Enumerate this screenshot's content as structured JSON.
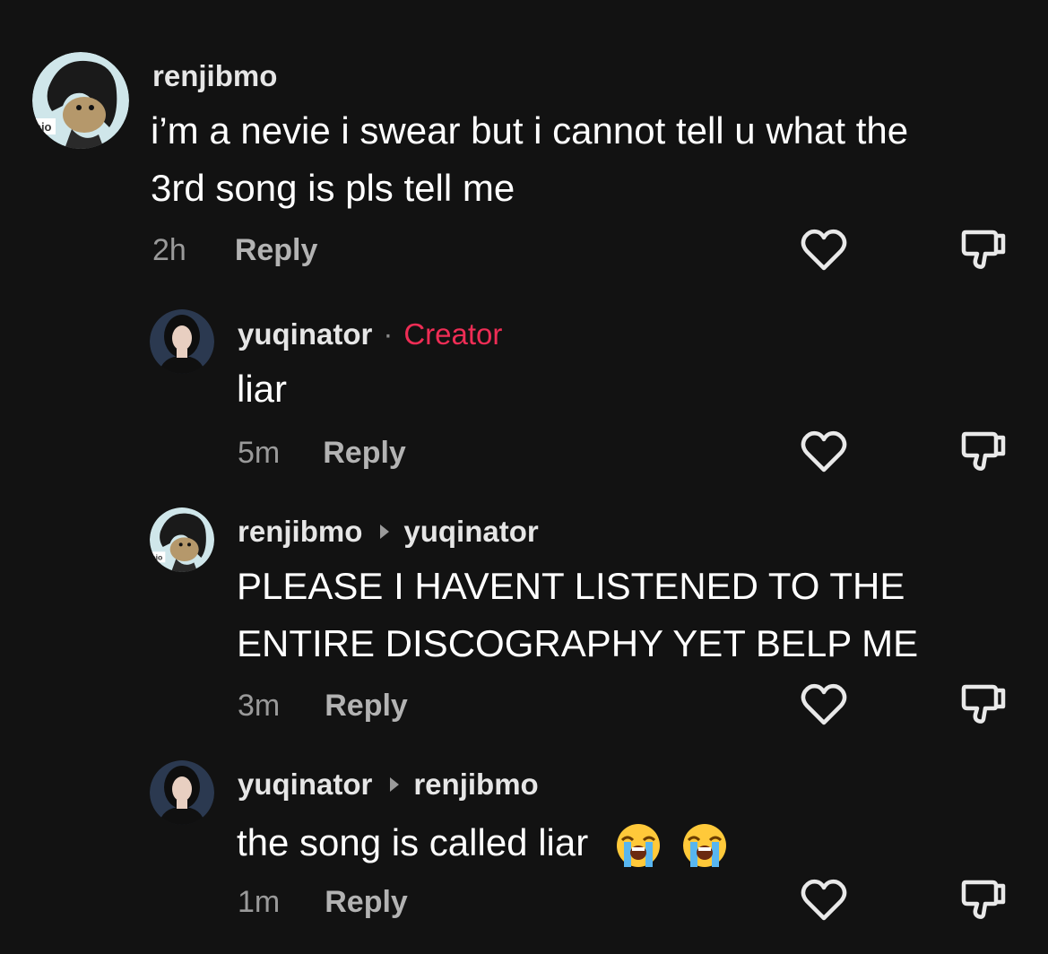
{
  "comments": [
    {
      "username": "renjibmo",
      "avatar_tag": "ojo",
      "text_lines": [
        "i’m a nevie i swear but i cannot tell u what the",
        "3rd song is pls tell me"
      ],
      "time": "2h",
      "reply_label": "Reply"
    },
    {
      "username": "yuqinator",
      "separator": "·",
      "badge": "Creator",
      "text_lines": [
        "liar"
      ],
      "time": "5m",
      "reply_label": "Reply"
    },
    {
      "username": "renjibmo",
      "avatar_tag": "ojo",
      "reply_to": "yuqinator",
      "text_lines": [
        "PLEASE I HAVENT LISTENED TO THE",
        "ENTIRE DISCOGRAPHY YET BELP ME"
      ],
      "time": "3m",
      "reply_label": "Reply"
    },
    {
      "username": "yuqinator",
      "reply_to": "renjibmo",
      "text_lines": [
        "the song is called liar"
      ],
      "emoji": [
        "loudly-crying-face",
        "loudly-crying-face"
      ],
      "time": "1m",
      "reply_label": "Reply"
    }
  ],
  "colors": {
    "background": "#121212",
    "creator_badge": "#ee2d55",
    "muted": "#9a9a9a"
  },
  "icons": [
    "heart-outline-icon",
    "thumbs-down-outline-icon",
    "reply-arrow-icon"
  ]
}
